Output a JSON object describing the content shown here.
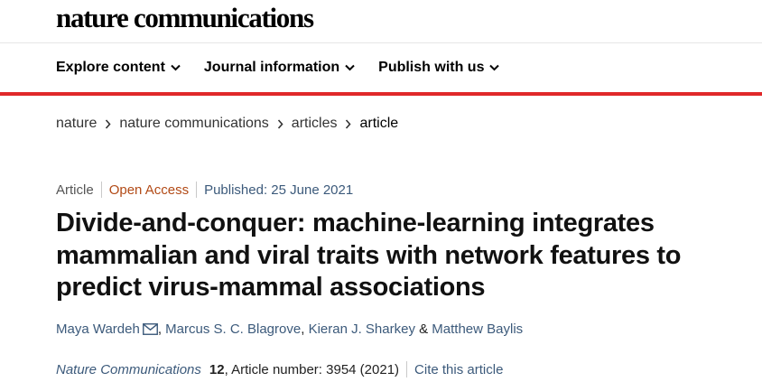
{
  "header": {
    "logo": "nature communications",
    "nav": [
      {
        "label": "Explore content",
        "icon": "chevron-down-icon"
      },
      {
        "label": "Journal information",
        "icon": "chevron-down-icon"
      },
      {
        "label": "Publish with us",
        "icon": "chevron-down-icon"
      }
    ],
    "accent_color": "#e0282a"
  },
  "breadcrumb": {
    "items": [
      "nature",
      "nature communications",
      "articles"
    ],
    "current": "article",
    "separator_icon": "chevron-right-icon"
  },
  "article": {
    "type": "Article",
    "access": "Open Access",
    "published": "Published: 25 June 2021",
    "title": "Divide-and-conquer: machine-learning integrates mammalian and viral traits with network features to predict virus-mammal associations",
    "authors": {
      "first": "Maya Wardeh",
      "second": "Marcus S. C. Blagrove",
      "third": "Kieran J. Sharkey",
      "last": "Matthew Baylis",
      "comma": ", ",
      "amp": " & ",
      "email_icon": "envelope-icon"
    },
    "citation": {
      "journal": "Nature Communications",
      "volume": "12",
      "details": ", Article number: 3954 (2021)",
      "cite_link": "Cite this article"
    }
  },
  "colors": {
    "link": "#3c5a7b",
    "open_access": "#b24a16"
  }
}
